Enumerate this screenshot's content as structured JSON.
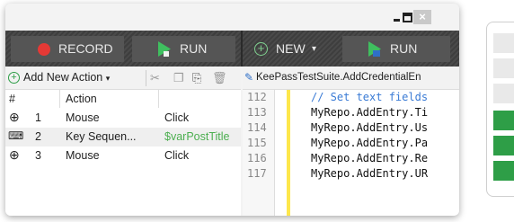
{
  "window": {
    "close_glyph": "×"
  },
  "toolbar": {
    "record_label": "RECORD",
    "run_label": "RUN",
    "new_label": "NEW",
    "run2_label": "RUN",
    "record_color": "#e53935",
    "accent_green": "#4caf50"
  },
  "actions_panel": {
    "add_label": "Add New Action",
    "columns": [
      "#",
      "Action"
    ],
    "rows": [
      {
        "num": "1",
        "icon": "mouse-icon",
        "action": "Mouse",
        "value": "Click"
      },
      {
        "num": "2",
        "icon": "keyboard-icon",
        "action": "Key Sequen...",
        "value": "$varPostTitle"
      },
      {
        "num": "3",
        "icon": "mouse-icon",
        "action": "Mouse",
        "value": "Click"
      }
    ]
  },
  "code_panel": {
    "tab_title": "KeePassTestSuite.AddCredentialEn",
    "lines": [
      {
        "no": "112",
        "text": "// Set text fields"
      },
      {
        "no": "113",
        "text": "MyRepo.AddEntry.Ti"
      },
      {
        "no": "114",
        "text": "MyRepo.AddEntry.Us"
      },
      {
        "no": "115",
        "text": "MyRepo.AddEntry.Pa"
      },
      {
        "no": "116",
        "text": "MyRepo.AddEntry.Re"
      },
      {
        "no": "117",
        "text": "MyRepo.AddEntry.UR"
      }
    ]
  },
  "side_panel": {
    "blocks": [
      "#e9e9e9",
      "#e9e9e9",
      "#e9e9e9",
      "#2e9e47",
      "#2e9e47",
      "#2e9e47"
    ]
  }
}
